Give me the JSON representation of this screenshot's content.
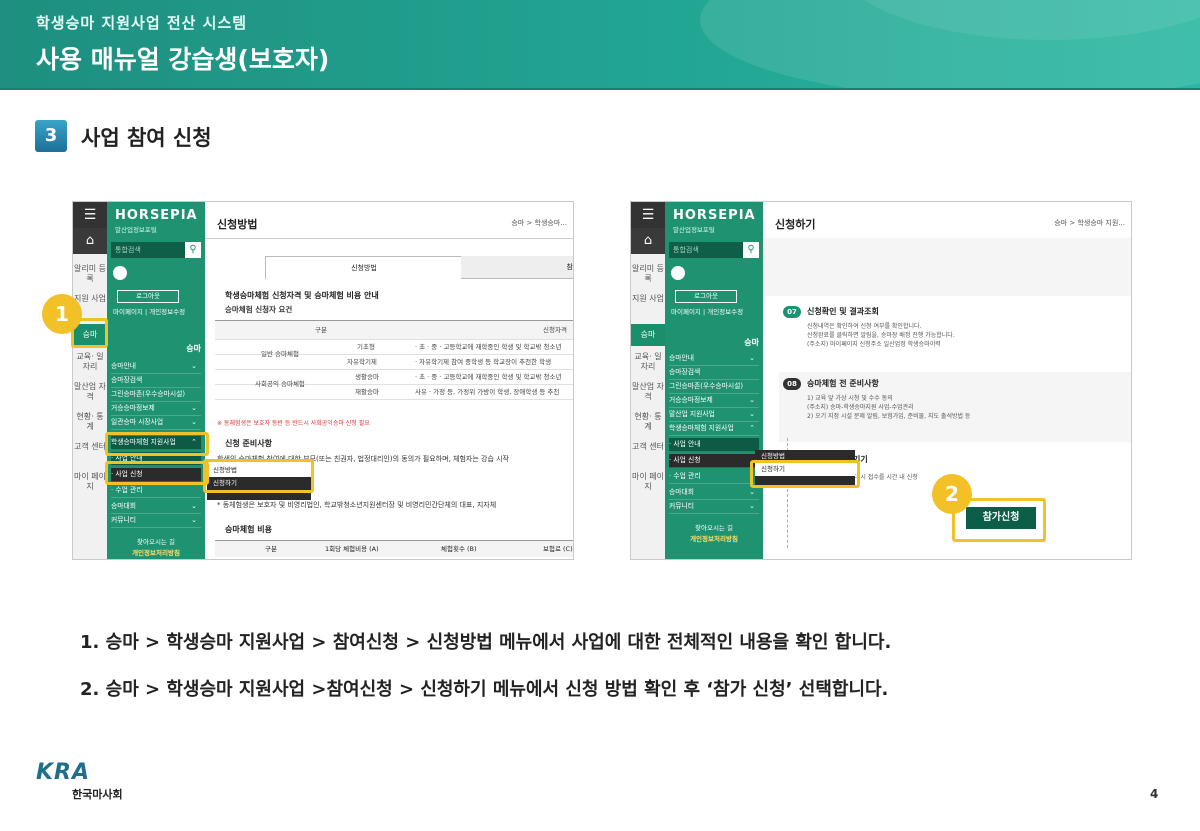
{
  "header": {
    "subtitle": "학생승마 지원사업 전산 시스템",
    "title": "사용 매뉴얼 강습생(보호자)"
  },
  "section": {
    "number": "3",
    "title": "사업 참여 신청"
  },
  "shot1": {
    "rail": [
      "알리미 등록",
      "지원 사업",
      "승마",
      "교육· 일자리",
      "말산업 자격",
      "현황· 통계",
      "고객 센터",
      "마이 페이지"
    ],
    "logo": "HORSEPIA",
    "logo_sub": "말산업정보포털",
    "search_placeholder": "통합검색",
    "login": "로그아웃",
    "my_links": "마이페이지 | 개인정보수정",
    "menu_head": "승마",
    "menu": [
      "승마안내",
      "승마장검색",
      "그린승마존(우수승마시설)",
      "거승승마정보제",
      "일관승마 시장사업",
      "학생승마체험 지원사업",
      "· 사업 안내",
      "· 사업 신청",
      "· 수업 관리",
      "승마대회",
      "커뮤니티"
    ],
    "foot1": "찾아오시는 길",
    "foot2": "개인정보처리방침",
    "page_title": "신청방법",
    "breadcrumb": "승마 > 학생승마...",
    "tab_active": "신청방법",
    "tab_other": "참",
    "notice_title": "학생승마체험 신청자격 및 승마체험 비용 안내",
    "notice_sub": "승마체험 신청자 요건",
    "table_head": [
      "구분",
      "신청자격"
    ],
    "rows": [
      [
        "일반 승마체험",
        "기초형",
        "· 초 · 중 · 고등학교에 재학중인 학생 및 학교밖 청소년"
      ],
      [
        "",
        "자유학기제",
        "· 자유학기제 참여 중학생 등 학교장이 추천한 학생"
      ],
      [
        "사회공익 승마체험",
        "생활승마",
        "· 초 · 중 · 고등학교에 재학중인 학생 및 학교밖 청소년"
      ],
      [
        "",
        "재활승마",
        "사유 · 가정 등, 가정위 가방이 학생, 장애학생 등 추천"
      ]
    ],
    "warn": "※ 동체험생은 보호자 동반 등 반드시 사회공익승마 신청 필요",
    "prep_title": "신청 준비사항",
    "prep_text": "학생의 승마체험 참여에 대한 부모(또는 친권자, 법정대리인)의 동의가 필요하며, 체험자는 강습 시작",
    "prep_text2": "* 동체험생은 보호자 및 비영리법인, 학교밖청소년지원센터장 및 비영리민간단체의 대표, 지자체",
    "cost_title": "승마체험 비용",
    "cost_head": [
      "구분",
      "1회당 체험비용 (A)",
      "체험횟수 (B)",
      "보험료 (C)"
    ],
    "popup": [
      "신청방법",
      "신청하기"
    ]
  },
  "shot2": {
    "rail": [
      "알리미 등록",
      "지원 사업",
      "승마",
      "교육· 일자리",
      "말산업 자격",
      "현황· 통계",
      "고객 센터",
      "마이 페이지"
    ],
    "logo": "HORSEPIA",
    "logo_sub": "말산업정보포털",
    "search_placeholder": "통합검색",
    "login": "로그아웃",
    "my_links": "마이페이지 | 개인정보수정",
    "menu_head": "승마",
    "menu": [
      "승마안내",
      "승마장검색",
      "그린승마존(우수승마시설)",
      "거승승마정보제",
      "말산업 지원사업",
      "학생승마체험 지원사업",
      "· 사업 안내",
      "· 사업 신청",
      "· 수업 관리",
      "승마대회",
      "커뮤니티"
    ],
    "foot1": "찾아오시는 길",
    "foot2": "개인정보처리방침",
    "page_title": "신청하기",
    "breadcrumb": "승마 > 학생승마 지원...",
    "step7_num": "07",
    "step7_title": "신청확인 및 결과조회",
    "step7_text": "신청내역은 확인하여 신청 여부를 확인합니다.\n신청완료를 클릭하면 알림을, 승마장 배정 진행 가능합니다.\n(주소지) 마이페이지 신청주소 일산업정 학생승마이력",
    "step8_num": "08",
    "step8_title": "승마체험 전 준비사항",
    "step8_text": "1) 교육 앞 가상 시청 및 수수 동의\n(주소지) 승마-학생승마지원 사업-수업관리\n2) 오기 지정 시설 문제 알림, 보험가입, 준비물, 지도 출석방법 등",
    "step_last_title": "기기",
    "step_last_text": "다 시 접수를 시간 내 신청",
    "popup": [
      "신청방법",
      "신청하기"
    ],
    "apply_button": "참가신청"
  },
  "badges": [
    "1",
    "2"
  ],
  "captions": [
    "1. 승마 > 학생승마 지원사업 > 참여신청 > 신청방법 메뉴에서 사업에 대한 전체적인 내용을 확인 합니다.",
    "2. 승마 > 학생승마 지원사업 >참여신청 > 신청하기 메뉴에서 신청 방법 확인 후 ‘참가 신청’ 선택합니다."
  ],
  "footer": {
    "logo": "KRA",
    "org": "한국마사회",
    "page": "4"
  },
  "colors": {
    "teal": "#22a593",
    "green": "#1f9272",
    "highlight": "#f2c027",
    "apply": "#0b5e48"
  }
}
